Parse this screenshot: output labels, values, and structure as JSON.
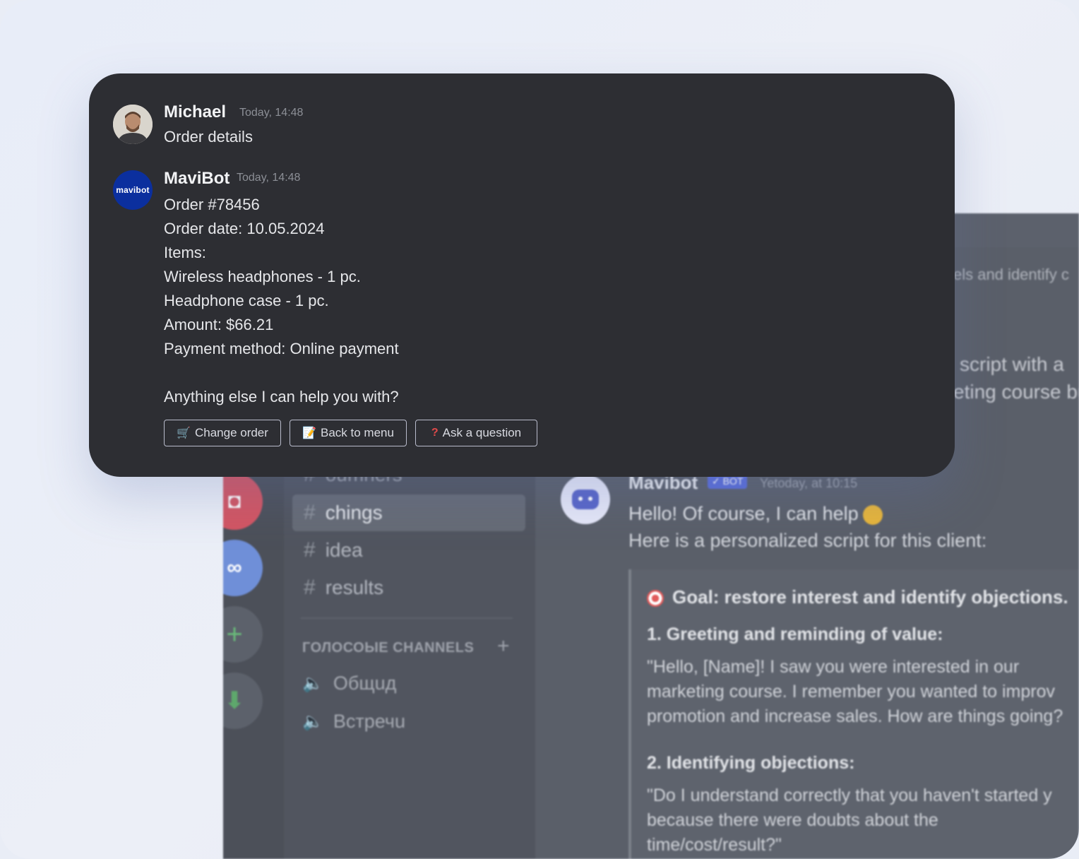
{
  "background_app": {
    "channels": {
      "cut_off_label": "oumners",
      "text_channels": [
        {
          "label": "chings",
          "active": true
        },
        {
          "label": "idea",
          "active": false
        },
        {
          "label": "results",
          "active": false
        }
      ],
      "voice_header": "ГОЛОСОЫЕ CHANNELS",
      "voice_channels": [
        "Общuд",
        "Встречu"
      ]
    },
    "chat_fragments": {
      "frag1": "els and identify c",
      "frag2": "script with a",
      "frag3": "eting course bu"
    },
    "bot_message": {
      "author": "Mavibot",
      "badge": "✓ BOT",
      "timestamp": "Yetoday, at 10:15",
      "line1": "Hello! Of course, I can help",
      "line2": "Here is a personalized script for this client:",
      "embed": {
        "goal": "Goal: restore interest and identify objections.",
        "heading1": "1. Greeting and reminding of value:",
        "para1": [
          "\"Hello, [Name]! I saw you were interested in our",
          "marketing course. I remember you wanted to improv",
          "promotion and increase sales. How are things going?"
        ],
        "heading2": "2. Identifying objections:",
        "para2": [
          "\"Do I understand correctly that you haven't started y",
          "because there were doubts about the",
          "time/cost/result?\""
        ]
      }
    }
  },
  "chat_card": {
    "messages": [
      {
        "author": "Michael",
        "timestamp": "Today, 14:48",
        "lines": [
          "Order details"
        ]
      },
      {
        "author": "MaviBot",
        "avatar_text": "mavibot",
        "timestamp": "Today, 14:48",
        "lines": [
          "Order #78456",
          "Order date: 10.05.2024",
          "Items:",
          "Wireless headphones - 1 pc.",
          "Headphone case - 1 pc.",
          "Amount: $66.21",
          "Payment method: Online payment",
          "Anything else I can help you with?"
        ]
      }
    ],
    "buttons": [
      {
        "label": "Change order",
        "icon": "shopping-cart-icon"
      },
      {
        "label": "Back to menu",
        "icon": "memo-icon"
      },
      {
        "label": "Ask a question",
        "icon": "question-mark-icon"
      }
    ]
  },
  "colors": {
    "card_bg": "#2d2e33",
    "mavibot_brand": "#0b2f9e",
    "bot_badge": "#5a6dd9"
  }
}
